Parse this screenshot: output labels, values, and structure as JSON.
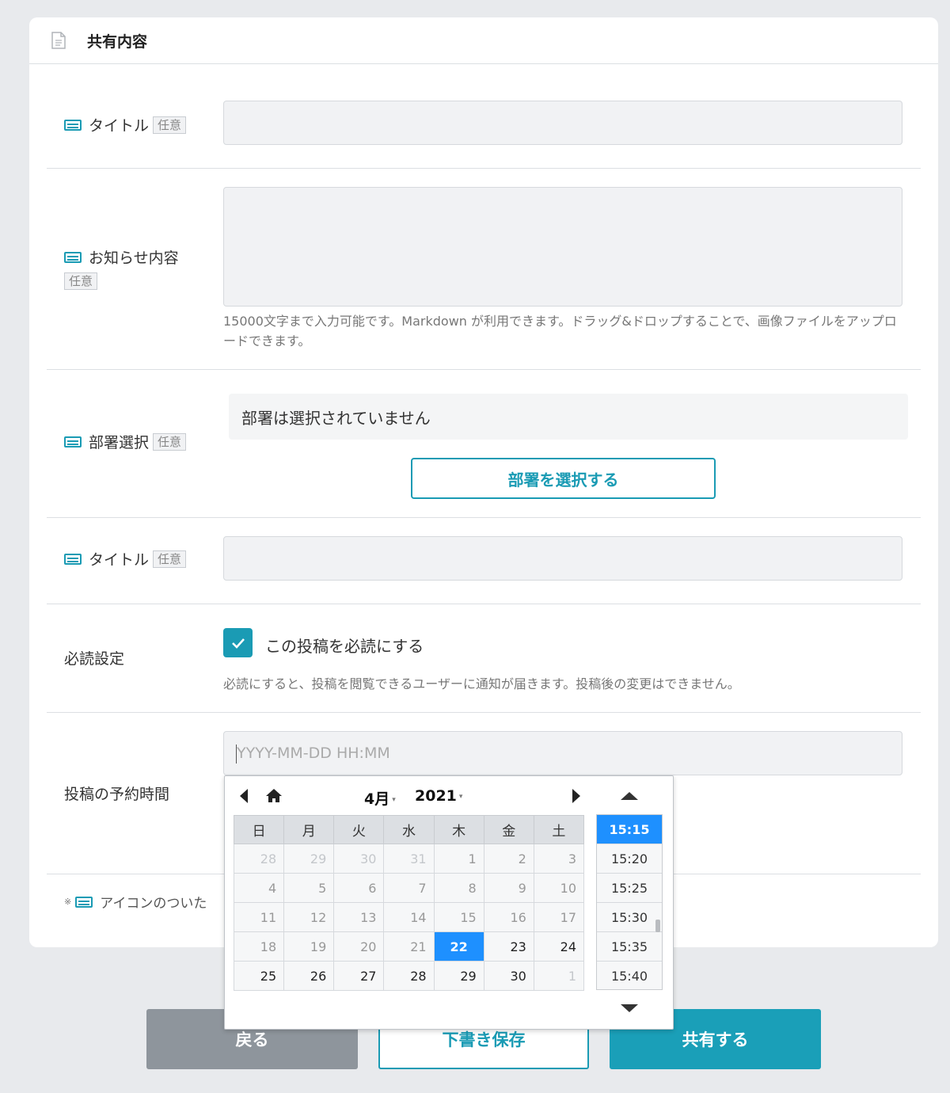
{
  "section": {
    "title": "共有内容"
  },
  "fields": {
    "title1": {
      "label": "タイトル",
      "badge": "任意",
      "value": ""
    },
    "notice": {
      "label": "お知らせ内容",
      "badge": "任意",
      "value": "",
      "help": "15000文字まで入力可能です。Markdown が利用できます。ドラッグ&ドロップすることで、画像ファイルをアップロードできます。"
    },
    "dept": {
      "label": "部署選択",
      "badge": "任意",
      "status": "部署は選択されていません",
      "button": "部署を選択する"
    },
    "title2": {
      "label": "タイトル",
      "badge": "任意",
      "value": ""
    },
    "must_read": {
      "label": "必読設定",
      "checkbox_label": "この投稿を必読にする",
      "checked": true,
      "help": "必読にすると、投稿を閲覧できるユーザーに通知が届きます。投稿後の変更はできません。"
    },
    "schedule": {
      "label": "投稿の予約時間",
      "placeholder": "YYYY-MM-DD HH:MM"
    }
  },
  "footnote": {
    "bullet": "※",
    "text": "アイコンのついた"
  },
  "buttons": {
    "back": "戻る",
    "draft": "下書き保存",
    "share": "共有する"
  },
  "datepicker": {
    "month": "4月",
    "year": "2021",
    "weekdays": [
      "日",
      "月",
      "火",
      "水",
      "木",
      "金",
      "土"
    ],
    "weeks": [
      [
        "28",
        "29",
        "30",
        "31",
        "1",
        "2",
        "3"
      ],
      [
        "4",
        "5",
        "6",
        "7",
        "8",
        "9",
        "10"
      ],
      [
        "11",
        "12",
        "13",
        "14",
        "15",
        "16",
        "17"
      ],
      [
        "18",
        "19",
        "20",
        "21",
        "22",
        "23",
        "24"
      ],
      [
        "25",
        "26",
        "27",
        "28",
        "29",
        "30",
        "1"
      ]
    ],
    "selected_day": "22",
    "times": [
      "15:15",
      "15:20",
      "15:25",
      "15:30",
      "15:35",
      "15:40"
    ],
    "selected_time": "15:15"
  },
  "colors": {
    "accent": "#1a9bb4",
    "selected": "#1e90ff",
    "back_button": "#8e959c"
  }
}
